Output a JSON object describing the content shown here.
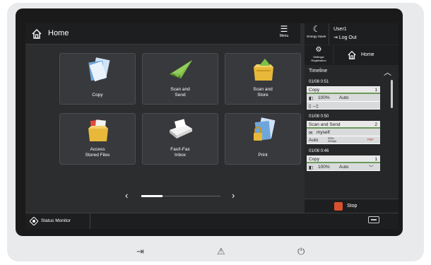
{
  "header": {
    "title": "Home",
    "menu_label": "Menu"
  },
  "tiles": [
    {
      "label": "Copy",
      "icon": "copy-icon"
    },
    {
      "label": "Scan and\nSend",
      "icon": "scan-send-icon"
    },
    {
      "label": "Scan and\nStore",
      "icon": "scan-store-icon"
    },
    {
      "label": "Access\nStored Files",
      "icon": "access-files-icon"
    },
    {
      "label": "Fax/I-Fax\nInbox",
      "icon": "fax-inbox-icon"
    },
    {
      "label": "Print",
      "icon": "print-icon"
    }
  ],
  "pager": {
    "prev": "‹",
    "next": "›"
  },
  "status": {
    "monitor_label": "Status Monitor"
  },
  "right_panel": {
    "energy_saver_label": "Energy Saver",
    "user_name": "User1",
    "logout_label": "Log Out",
    "settings_label": "Settings/\nRegistration",
    "home_label": "Home",
    "timeline_label": "Timeline",
    "stop_label": "Stop"
  },
  "jobs": [
    {
      "time": "01/08 0:51",
      "name": "Copy",
      "count": "1",
      "zoom": "100%",
      "mode": "Auto"
    },
    {
      "time": "01/08 0:50",
      "name": "Scan and Send",
      "count": "2",
      "dest": "myself",
      "mode": "Auto",
      "res": "200x\n200dpi",
      "format": "PDF"
    },
    {
      "time": "01/08 0:46",
      "name": "Copy",
      "count": "1",
      "zoom": "100%",
      "mode": "Auto"
    }
  ],
  "colors": {
    "screen_bg": "#2c2d2f",
    "topbar_bg": "#1d1e20",
    "stop_red": "#d9502e",
    "tile_bg": "#38393c"
  }
}
